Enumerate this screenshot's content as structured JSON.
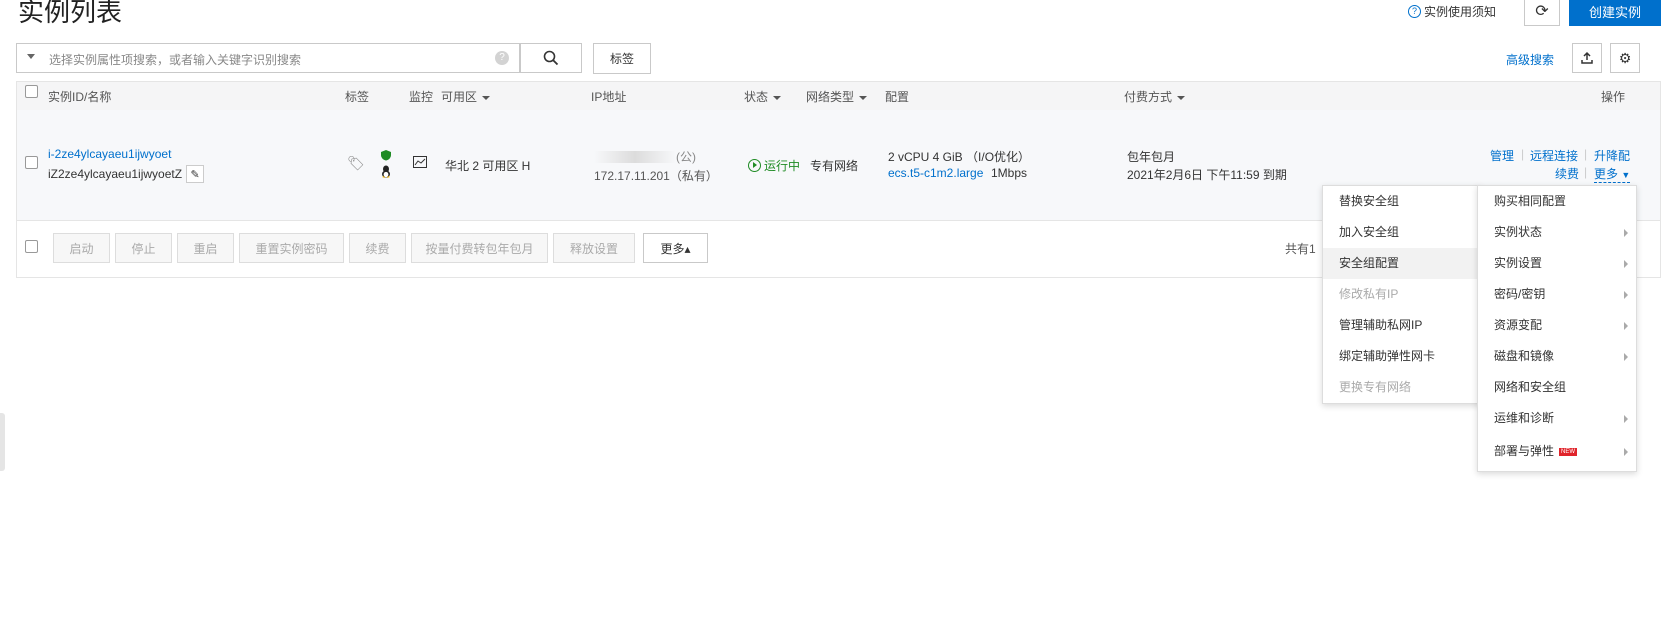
{
  "header": {
    "title": "实例列表",
    "help_label": "实例使用须知",
    "create_label": "创建实例"
  },
  "toolbar": {
    "search_placeholder": "选择实例属性项搜索，或者输入关键字识别搜索",
    "tag_label": "标签",
    "advanced_search_label": "高级搜索"
  },
  "table": {
    "columns": {
      "id_name": "实例ID/名称",
      "tags": "标签",
      "monitor": "监控",
      "zone": "可用区",
      "ip": "IP地址",
      "status": "状态",
      "network": "网络类型",
      "config": "配置",
      "billing": "付费方式",
      "actions": "操作"
    },
    "row": {
      "instance_id": "i-2ze4ylcayaeu1ijwyoet",
      "instance_name": "iZ2ze4ylcayaeu1ijwyoetZ",
      "zone": "华北 2 可用区 H",
      "public_ip_suffix": "(公)",
      "private_ip": "172.17.11.201（私有）",
      "status": "运行中",
      "network": "专有网络",
      "config_line1": "2 vCPU 4 GiB （I/O优化）",
      "instance_type": "ecs.t5-c1m2.large",
      "bandwidth": "1Mbps",
      "billing_type": "包年包月",
      "expire": "2021年2月6日 下午11:59 到期",
      "actions": {
        "manage": "管理",
        "remote": "远程连接",
        "upgrade": "升降配",
        "renew": "续费",
        "more": "更多"
      }
    },
    "footer": {
      "buttons": [
        "启动",
        "停止",
        "重启",
        "重置实例密码",
        "续费",
        "按量付费转包年包月",
        "释放设置"
      ],
      "more_label": "更多▴",
      "total_partial": "共有1"
    }
  },
  "submenu": {
    "items": [
      "替换安全组",
      "加入安全组",
      "安全组配置",
      "修改私有IP",
      "管理辅助私网IP",
      "绑定辅助弹性网卡",
      "更换专有网络"
    ]
  },
  "more_menu": {
    "items": [
      "购买相同配置",
      "实例状态",
      "实例设置",
      "密码/密钥",
      "资源变配",
      "磁盘和镜像",
      "网络和安全组",
      "运维和诊断",
      "部署与弹性"
    ],
    "new_badge": "NEW"
  }
}
